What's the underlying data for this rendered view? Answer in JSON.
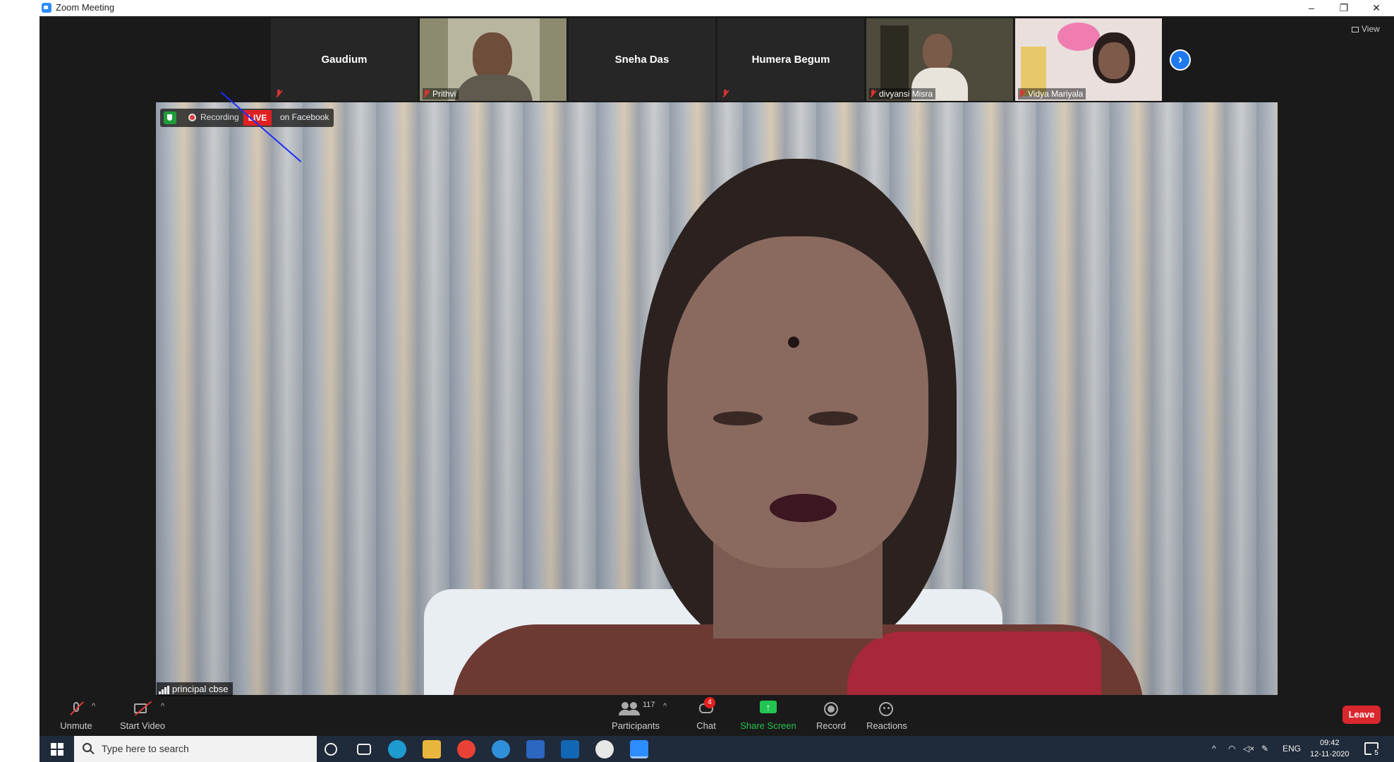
{
  "window": {
    "title": "Zoom Meeting",
    "minimize": "–",
    "restore": "❐",
    "close": "✕"
  },
  "top_strip": {
    "view_label": "View",
    "participants": [
      {
        "name": "Gaudium",
        "video": false,
        "muted": true
      },
      {
        "name": "Prithvi",
        "video": true,
        "muted": true
      },
      {
        "name": "Sneha Das",
        "video": false,
        "muted": false
      },
      {
        "name": "Humera Begum",
        "video": false,
        "muted": true
      },
      {
        "name": "divyansi Misra",
        "video": true,
        "muted": true
      },
      {
        "name": "Vidya Mariyala",
        "video": true,
        "muted": true
      }
    ],
    "next_page": "›"
  },
  "main_video": {
    "recording_label": "Recording",
    "live_label": "LIVE",
    "stream_target": "on Facebook",
    "speaker_name": "principal cbse"
  },
  "toolbar": {
    "unmute": "Unmute",
    "start_video": "Start Video",
    "participants": "Participants",
    "participants_count": "117",
    "chat": "Chat",
    "chat_badge": "4",
    "share_screen": "Share Screen",
    "record": "Record",
    "reactions": "Reactions",
    "leave": "Leave"
  },
  "taskbar": {
    "search_placeholder": "Type here to search",
    "language": "ENG",
    "time": "09:42",
    "date": "12-11-2020",
    "notifications": "5"
  },
  "colors": {
    "zoom_blue": "#2d8cff",
    "live_red": "#e02020",
    "share_green": "#23c552",
    "leave_red": "#d9272e"
  }
}
